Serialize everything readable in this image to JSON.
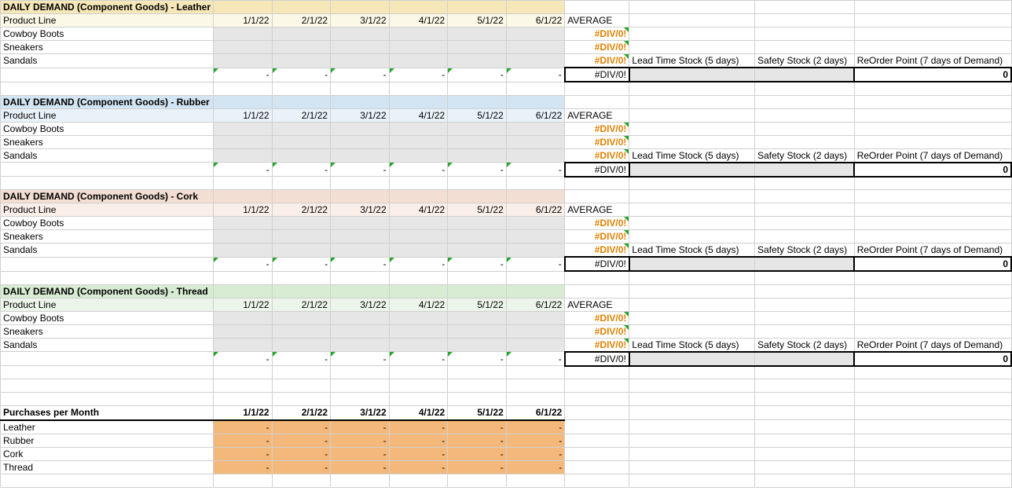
{
  "dates": [
    "1/1/22",
    "2/1/22",
    "3/1/22",
    "4/1/22",
    "5/1/22",
    "6/1/22"
  ],
  "productLineLabel": "Product Line",
  "averageLabel": "AVERAGE",
  "products": [
    "Cowboy Boots",
    "Sneakers",
    "Sandals"
  ],
  "divError": "#DIV/0!",
  "dash": "-",
  "sections": {
    "leather": {
      "title": "DAILY DEMAND (Component Goods) - Leather"
    },
    "rubber": {
      "title": "DAILY DEMAND (Component Goods) - Rubber"
    },
    "cork": {
      "title": "DAILY DEMAND (Component Goods) - Cork"
    },
    "thread": {
      "title": "DAILY DEMAND (Component Goods) - Thread"
    }
  },
  "stock": {
    "leadTime": "Lead Time Stock (5 days)",
    "safety": "Safety Stock (2 days)",
    "reorder": "ReOrder Point (7 days of Demand)"
  },
  "zero": "0",
  "purchases": {
    "title": "Purchases per Month",
    "rows": [
      "Leather",
      "Rubber",
      "Cork",
      "Thread"
    ]
  }
}
